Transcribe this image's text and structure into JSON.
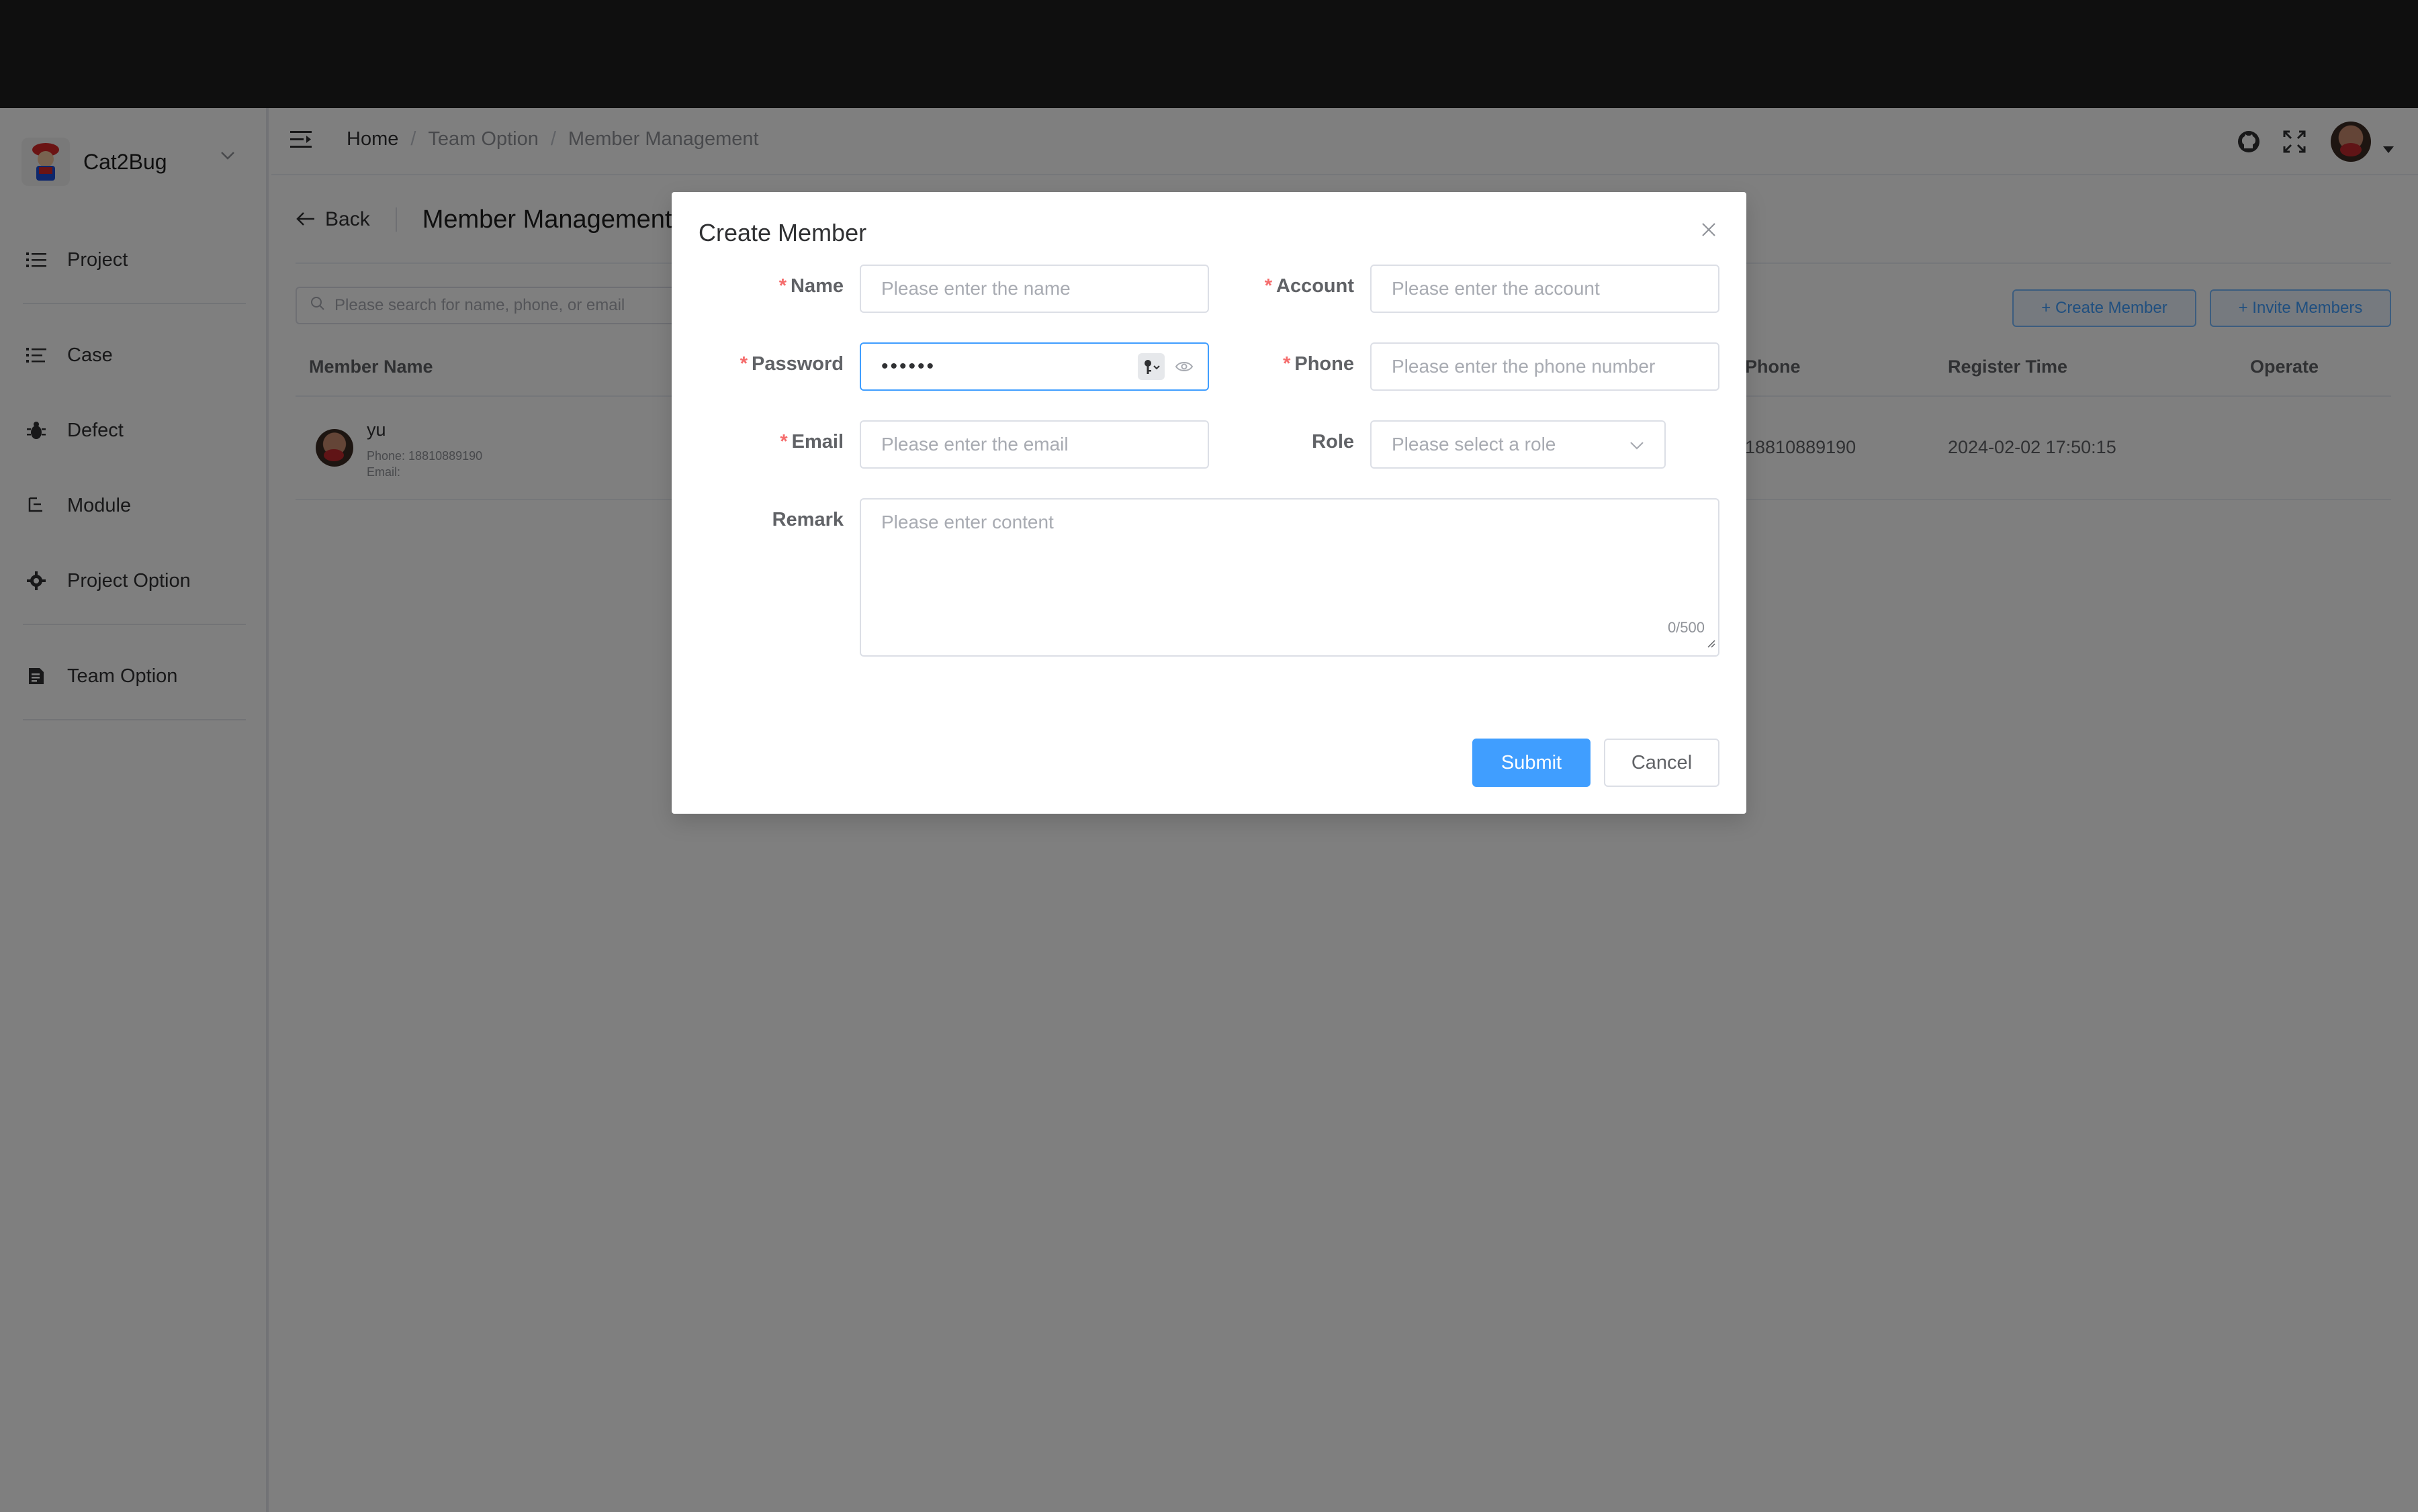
{
  "sidebar": {
    "brand": "Cat2Bug",
    "items": [
      {
        "label": "Project",
        "icon": "list-icon"
      },
      {
        "label": "Case",
        "icon": "list-check-icon"
      },
      {
        "label": "Defect",
        "icon": "bug-icon"
      },
      {
        "label": "Module",
        "icon": "module-icon"
      },
      {
        "label": "Project Option",
        "icon": "gear-icon"
      },
      {
        "label": "Team Option",
        "icon": "document-icon"
      }
    ]
  },
  "breadcrumb": {
    "home": "Home",
    "sep": "/",
    "items": [
      "Team Option",
      "Member Management"
    ]
  },
  "page": {
    "back_label": "Back",
    "title": "Member Management",
    "search_placeholder": "Please search for name, phone, or email",
    "create_button": "+ Create Member",
    "invite_button": "+ Invite Members"
  },
  "table": {
    "columns": [
      "Member Name",
      "Phone",
      "Register Time",
      "Operate"
    ],
    "rows": [
      {
        "name": "yu",
        "phone_line": "Phone: 18810889190",
        "email_line": "Email:",
        "phone": "18810889190",
        "register_time": "2024-02-02 17:50:15"
      }
    ]
  },
  "dialog": {
    "title": "Create Member",
    "fields": {
      "name": {
        "label": "Name",
        "placeholder": "Please enter the name"
      },
      "account": {
        "label": "Account",
        "placeholder": "Please enter the account"
      },
      "password": {
        "label": "Password",
        "value": "••••••"
      },
      "phone": {
        "label": "Phone",
        "placeholder": "Please enter the phone number"
      },
      "email": {
        "label": "Email",
        "placeholder": "Please enter the email"
      },
      "role": {
        "label": "Role",
        "placeholder": "Please select a role"
      },
      "remark": {
        "label": "Remark",
        "placeholder": "Please enter content",
        "counter": "0/500"
      }
    },
    "required_mark": "*",
    "submit": "Submit",
    "cancel": "Cancel"
  },
  "colors": {
    "primary": "#409eff",
    "danger": "#f56c6c",
    "topbar": "#1f1f1f"
  }
}
